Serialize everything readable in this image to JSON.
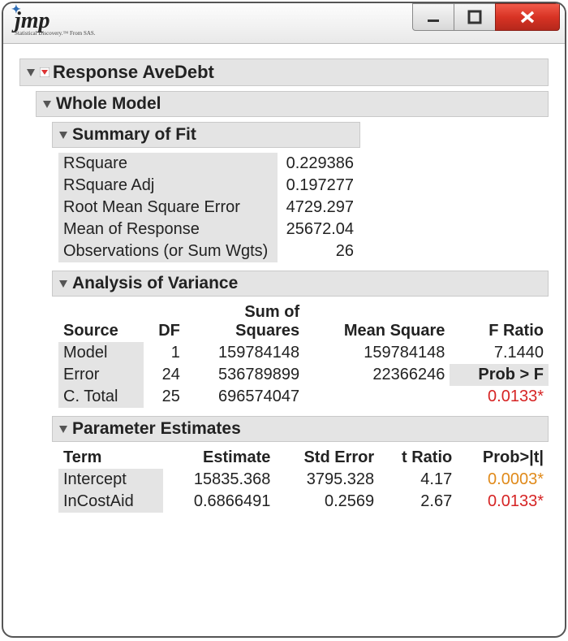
{
  "titlebar": {
    "logo_text": "jmp",
    "logo_sub": "Statistical Discovery.™ From SAS."
  },
  "response": {
    "title": "Response AveDebt"
  },
  "whole_model": {
    "title": "Whole Model"
  },
  "summary_of_fit": {
    "title": "Summary of Fit",
    "rows": [
      {
        "label": "RSquare",
        "value": "0.229386"
      },
      {
        "label": "RSquare Adj",
        "value": "0.197277"
      },
      {
        "label": "Root Mean Square Error",
        "value": "4729.297"
      },
      {
        "label": "Mean of Response",
        "value": "25672.04"
      },
      {
        "label": "Observations (or Sum Wgts)",
        "value": "26"
      }
    ]
  },
  "anova": {
    "title": "Analysis of Variance",
    "headers": {
      "source": "Source",
      "df": "DF",
      "ss_line1": "Sum of",
      "ss_line2": "Squares",
      "ms": "Mean Square",
      "fratio": "F Ratio"
    },
    "probf_label": "Prob > F",
    "probf_value": "0.0133*",
    "rows": [
      {
        "source": "Model",
        "df": "1",
        "ss": "159784148",
        "ms": "159784148",
        "f": "7.1440"
      },
      {
        "source": "Error",
        "df": "24",
        "ss": "536789899",
        "ms": "22366246",
        "f": ""
      },
      {
        "source": "C. Total",
        "df": "25",
        "ss": "696574047",
        "ms": "",
        "f": ""
      }
    ]
  },
  "params": {
    "title": "Parameter Estimates",
    "headers": {
      "term": "Term",
      "estimate": "Estimate",
      "stderr": "Std Error",
      "tratio": "t Ratio",
      "probt": "Prob>|t|"
    },
    "rows": [
      {
        "term": "Intercept",
        "estimate": "15835.368",
        "stderr": "3795.328",
        "t": "4.17",
        "p": "0.0003*",
        "pclass": "sig-orange"
      },
      {
        "term": "InCostAid",
        "estimate": "0.6866491",
        "stderr": "0.2569",
        "t": "2.67",
        "p": "0.0133*",
        "pclass": "sig-red"
      }
    ]
  }
}
